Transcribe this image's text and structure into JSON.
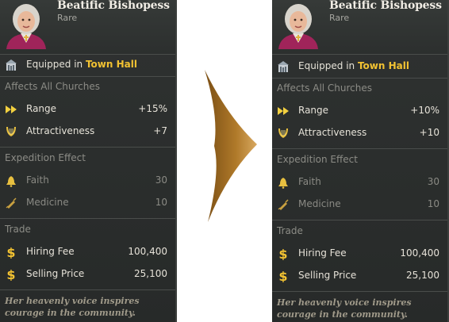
{
  "cards": [
    {
      "title": "Beatific Bishopess",
      "rarity": "Rare",
      "equipped_prefix": "Equipped in",
      "equipped_building": "Town Hall",
      "affects_label": "Affects All Churches",
      "stats": [
        {
          "label": "Range",
          "value": "+15%",
          "icon": "double-arrow-icon"
        },
        {
          "label": "Attractiveness",
          "value": "+7",
          "icon": "lyre-icon"
        }
      ],
      "expedition_label": "Expedition Effect",
      "expedition": [
        {
          "label": "Faith",
          "value": "30",
          "icon": "bell-icon"
        },
        {
          "label": "Medicine",
          "value": "10",
          "icon": "syringe-icon"
        }
      ],
      "trade_label": "Trade",
      "trade": [
        {
          "label": "Hiring Fee",
          "value": "100,400",
          "icon": "dollar-icon"
        },
        {
          "label": "Selling Price",
          "value": "25,100",
          "icon": "dollar-icon"
        }
      ],
      "flavor": "Her heavenly voice inspires courage in the community."
    },
    {
      "title": "Beatific Bishopess",
      "rarity": "Rare",
      "equipped_prefix": "Equipped in",
      "equipped_building": "Town Hall",
      "affects_label": "Affects All Churches",
      "stats": [
        {
          "label": "Range",
          "value": "+10%",
          "icon": "double-arrow-icon"
        },
        {
          "label": "Attractiveness",
          "value": "+10",
          "icon": "lyre-icon"
        }
      ],
      "expedition_label": "Expedition Effect",
      "expedition": [
        {
          "label": "Faith",
          "value": "30",
          "icon": "bell-icon"
        },
        {
          "label": "Medicine",
          "value": "10",
          "icon": "syringe-icon"
        }
      ],
      "trade_label": "Trade",
      "trade": [
        {
          "label": "Hiring Fee",
          "value": "100,400",
          "icon": "dollar-icon"
        },
        {
          "label": "Selling Price",
          "value": "25,100",
          "icon": "dollar-icon"
        }
      ],
      "flavor": "Her heavenly voice inspires courage in the community."
    }
  ],
  "colors": {
    "highlight": "#f2c232",
    "panel": "#2c2f2e",
    "arrow": "#b07a2a"
  }
}
